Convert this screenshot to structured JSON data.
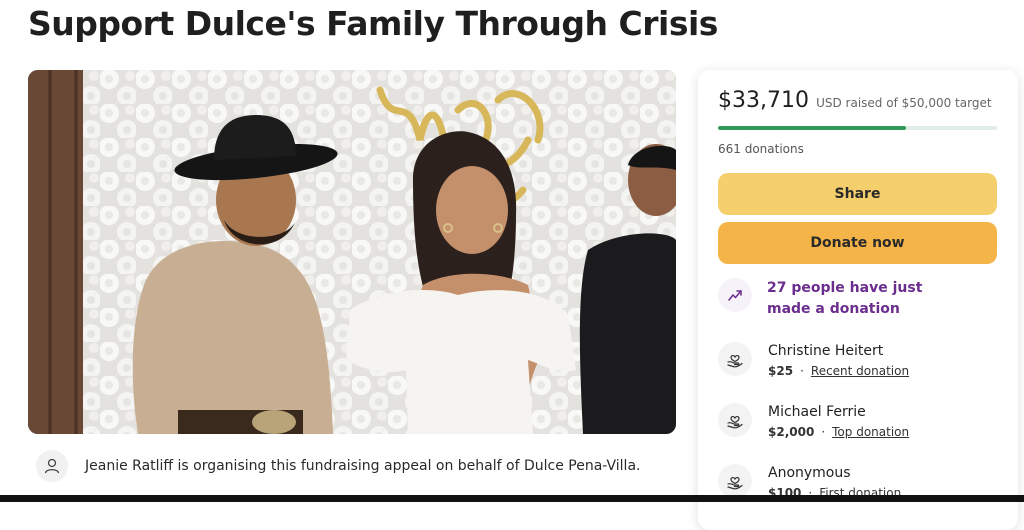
{
  "page": {
    "title": "Support Dulce's Family Through Crisis"
  },
  "photo": {
    "alt_signage": "Mr & Mrs"
  },
  "organiser": {
    "text": "Jeanie Ratliff is organising this fundraising appeal on behalf of Dulce Pena-Villa."
  },
  "sidebar": {
    "amount": "$33,710",
    "raised_text": "USD raised of $50,000 target",
    "progress_fraction": 0.674,
    "donations_count": "661 donations",
    "share_label": "Share",
    "donate_label": "Donate now",
    "recent_text": "27 people have just made a donation",
    "donors": [
      {
        "name": "Christine Heitert",
        "amount": "$25",
        "tag": "Recent donation"
      },
      {
        "name": "Michael Ferrie",
        "amount": "$2,000",
        "tag": "Top donation"
      },
      {
        "name": "Anonymous",
        "amount": "$100",
        "tag": "First donation"
      }
    ]
  },
  "colors": {
    "progress_fill": "#34995a",
    "share_button": "#f5cf6b",
    "donate_button": "#f4b447",
    "recent_text": "#6b2d8e"
  },
  "icons": [
    "user-icon",
    "trending-up-icon",
    "heart-hand-icon"
  ]
}
